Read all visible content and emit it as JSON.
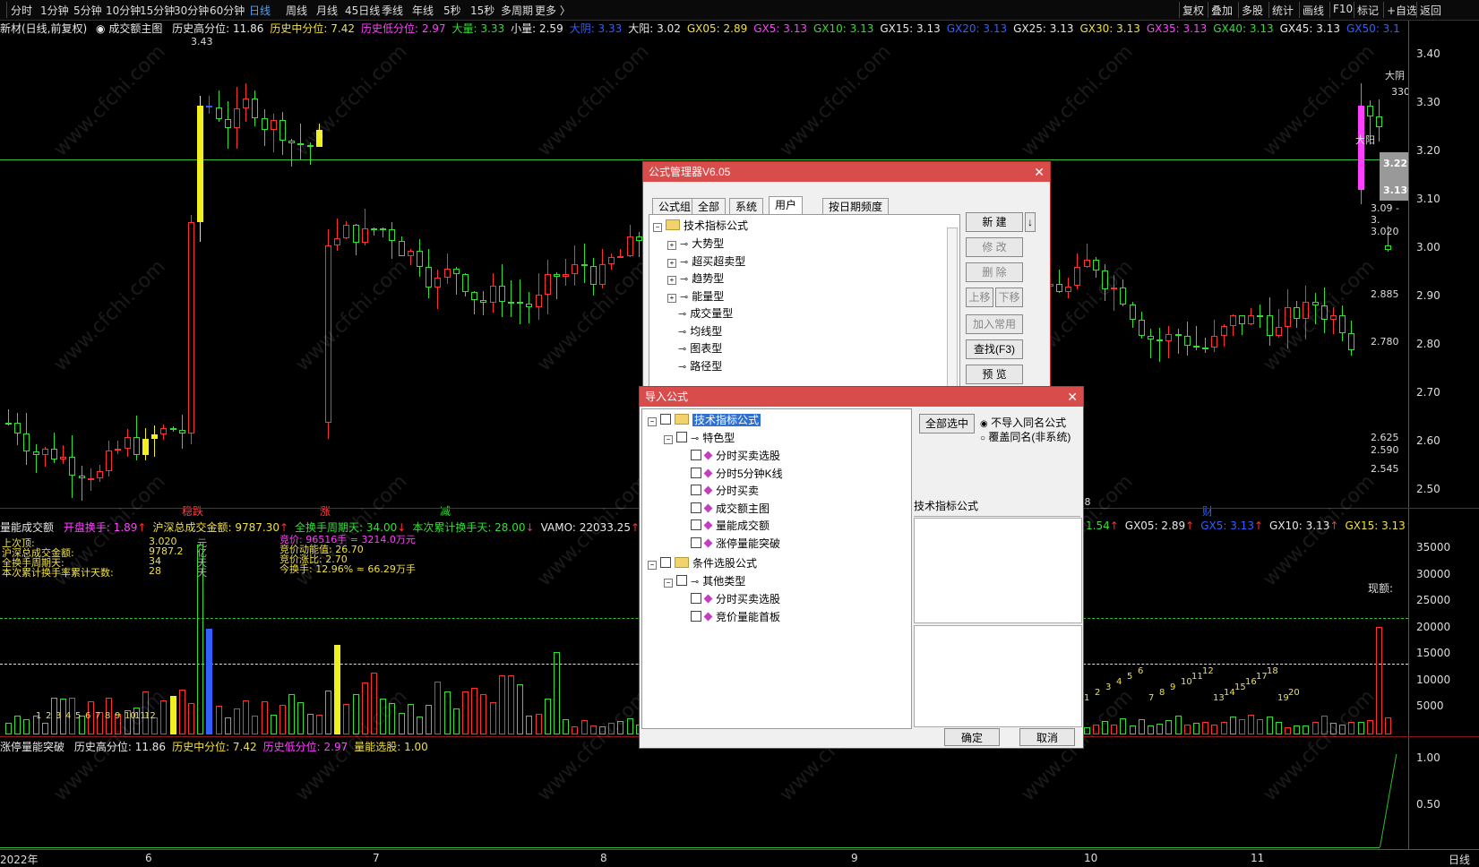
{
  "toolbar": {
    "periods": [
      "分时",
      "1分钟",
      "5分钟",
      "10分钟",
      "15分钟",
      "30分钟",
      "60分钟",
      "日线",
      "周线",
      "月线",
      "45日线",
      "季线",
      "年线",
      "5秒",
      "15秒",
      "多周期",
      "更多 〉"
    ],
    "active": "日线",
    "right": [
      "复权",
      "叠加",
      "多股",
      "统计",
      "画线",
      "F10",
      "标记",
      "+自选",
      "返回"
    ]
  },
  "main_info": {
    "stock": "新材(日线,前复权)",
    "indicator": "成交额主图",
    "items": [
      {
        "t": "历史高分位: 11.86",
        "c": "w"
      },
      {
        "t": "历史中分位: 7.42",
        "c": "y"
      },
      {
        "t": "历史低分位: 2.97",
        "c": "m"
      },
      {
        "t": "大量: 3.33",
        "c": "g"
      },
      {
        "t": "小量: 2.59",
        "c": "w"
      },
      {
        "t": "大阴: 3.33",
        "c": "b"
      },
      {
        "t": "大阳: 3.02",
        "c": "w"
      },
      {
        "t": "GX05: 2.89",
        "c": "y"
      },
      {
        "t": "GX5: 3.13",
        "c": "m"
      },
      {
        "t": "GX10: 3.13",
        "c": "g"
      },
      {
        "t": "GX15: 3.13",
        "c": "w"
      },
      {
        "t": "GX20: 3.13",
        "c": "b"
      },
      {
        "t": "GX25: 3.13",
        "c": "w"
      },
      {
        "t": "GX30: 3.13",
        "c": "y"
      },
      {
        "t": "GX35: 3.13",
        "c": "m"
      },
      {
        "t": "GX40: 3.13",
        "c": "g"
      },
      {
        "t": "GX45: 3.13",
        "c": "w"
      },
      {
        "t": "GX50: 3.1",
        "c": "b"
      }
    ]
  },
  "price_axis": [
    "3.40",
    "3.30",
    "3.20",
    "3.10",
    "3.00",
    "2.90",
    "2.80",
    "2.70",
    "2.60",
    "2.50"
  ],
  "price_marks": {
    "hi_label": "3.43",
    "lo_label": "2.48",
    "right_labels": [
      "3.020",
      "2.885",
      "2.780",
      "2.625",
      "2.590",
      "2.545",
      "3.09 - 3.",
      "330"
    ],
    "box_labels": [
      "3.225",
      "3.130"
    ],
    "tags": [
      "大阴",
      "大阳"
    ]
  },
  "event_tags": [
    "稳跌",
    "涨",
    "减",
    "财"
  ],
  "vol_info": {
    "title": "量能成交额",
    "items": [
      {
        "t": "开盘换手: 1.89",
        "c": "m"
      },
      {
        "t": "沪深总成交金额: 9787.30",
        "c": "y"
      },
      {
        "t": "全换手周期天: 34.00",
        "c": "g"
      },
      {
        "t": "本次累计换手天: 28.00",
        "c": "g"
      },
      {
        "t": "VAMO: 22033.25",
        "c": "w"
      },
      {
        "t": "AMOW",
        "c": "b"
      }
    ],
    "right_items": [
      {
        "t": "1.54",
        "c": "g"
      },
      {
        "t": "GX05: 2.89",
        "c": "w"
      },
      {
        "t": "GX5: 3.13",
        "c": "b"
      },
      {
        "t": "GX10: 3.13",
        "c": "w"
      },
      {
        "t": "GX15: 3.13",
        "c": "y"
      },
      {
        "t": "GX20: 3.13",
        "c": "m"
      }
    ]
  },
  "vol_axis": [
    "35000",
    "30000",
    "25000",
    "20000",
    "15000",
    "10000",
    "5000"
  ],
  "vol_stats": {
    "left_labels": [
      "上次顶:",
      "沪深总成交金额:",
      "全换手周期天:",
      "本次累计换手率累计天数:"
    ],
    "left_values": [
      "3.020",
      "9787.2",
      "34",
      "28"
    ],
    "left_units": [
      "元",
      "亿",
      "天",
      "天"
    ],
    "mid_lines": [
      "竞价: 96516手 = 3214.0万元",
      "竞价动能值: 26.70",
      "竞价涨比: 2.70",
      "今换手: 12.96%  ≈  66.29万手"
    ],
    "now_label": "现额:"
  },
  "vol_counts": [
    "1",
    "2",
    "3",
    "4",
    "5",
    "6",
    "7",
    "8",
    "9",
    "10",
    "11",
    "12",
    "1",
    "2",
    "3",
    "4",
    "5",
    "6",
    "7",
    "8",
    "9",
    "10",
    "11",
    "12",
    "13",
    "14",
    "15",
    "16",
    "17",
    "18",
    "19",
    "20"
  ],
  "bottom_info": {
    "title": "涨停量能突破",
    "items": [
      {
        "t": "历史高分位: 11.86",
        "c": "w"
      },
      {
        "t": "历史中分位: 7.42",
        "c": "y"
      },
      {
        "t": "历史低分位: 2.97",
        "c": "m"
      },
      {
        "t": "量能选股: 1.00",
        "c": "y"
      }
    ]
  },
  "bottom_axis": [
    "1.00",
    "0.50"
  ],
  "x_axis": [
    "2022年",
    "6",
    "7",
    "8",
    "9",
    "10",
    "11"
  ],
  "x_axis_right": "日线",
  "watermark": "www.cfchi.com",
  "formula_manager": {
    "title": "公式管理器V6.05",
    "tabs": [
      "公式组",
      "全部",
      "系统",
      "用户",
      "按日期频度"
    ],
    "selected_tab": "用户",
    "root": "技术指标公式",
    "items": [
      "大势型",
      "超买超卖型",
      "趋势型",
      "能量型",
      "成交量型",
      "均线型",
      "图表型",
      "路径型"
    ],
    "buttons": [
      "新 建",
      "修 改",
      "删 除",
      "上移",
      "下移",
      "加入常用",
      "查找(F3)",
      "预 览"
    ]
  },
  "import_dialog": {
    "title": "导入公式",
    "root1": "技术指标公式",
    "group1": "特色型",
    "items1": [
      "分时买卖选股",
      "分时5分钟K线",
      "分时买卖",
      "成交额主图",
      "量能成交额",
      "涨停量能突破"
    ],
    "root2": "条件选股公式",
    "group2": "其他类型",
    "items2": [
      "分时买卖选股",
      "竞价量能首板"
    ],
    "select_all": "全部选中",
    "radio1": "不导入同名公式",
    "radio2": "覆盖同名(非系统)",
    "desc": "技术指标公式",
    "ok": "确定",
    "cancel": "取消"
  }
}
